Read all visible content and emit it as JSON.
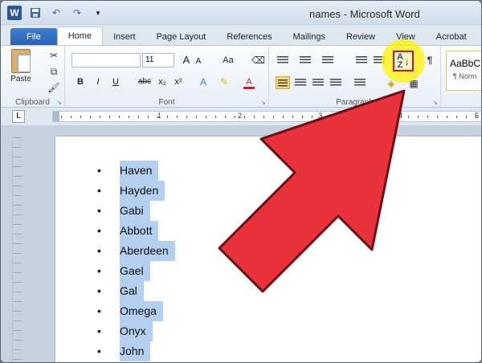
{
  "window": {
    "title": "names - Microsoft Word"
  },
  "tabs": [
    {
      "label": "File"
    },
    {
      "label": "Home"
    },
    {
      "label": "Insert"
    },
    {
      "label": "Page Layout"
    },
    {
      "label": "References"
    },
    {
      "label": "Mailings"
    },
    {
      "label": "Review"
    },
    {
      "label": "View"
    },
    {
      "label": "Acrobat"
    }
  ],
  "ribbon": {
    "clipboard": {
      "label": "Clipboard",
      "paste_label": "Paste"
    },
    "font": {
      "label": "Font",
      "font_name": "",
      "font_size": "11",
      "grow_label": "A",
      "shrink_label": "A",
      "case_label": "Aa",
      "bold_label": "B",
      "italic_label": "I",
      "underline_label": "U",
      "strike_label": "abc",
      "subscript_label": "x₂",
      "superscript_label": "x²",
      "color_label": "A"
    },
    "paragraph": {
      "label": "Paragraph",
      "sort_top": "A",
      "sort_bottom": "Z",
      "pilcrow": "¶"
    },
    "styles": {
      "preview": "AaBbC",
      "normal_label": "¶ Norm"
    }
  },
  "ruler": {
    "tab_glyph": "L",
    "numbers": [
      "1",
      "2",
      "3",
      "4",
      "5"
    ]
  },
  "document": {
    "names": [
      "Haven",
      "Hayden",
      "Gabi",
      "Abbott",
      "Aberdeen",
      "Gael",
      "Gal",
      "Omega",
      "Onyx",
      "John"
    ]
  },
  "colors": {
    "selection": "#b4cff0",
    "arrow": "#e8323c",
    "highlight": "#fff100",
    "ribbon_accent": "#2b579a"
  }
}
